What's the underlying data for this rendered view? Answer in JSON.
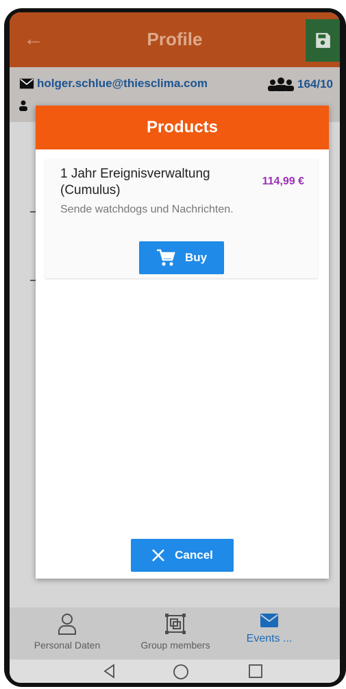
{
  "appbar": {
    "title": "Profile",
    "back_icon": "arrow-left-icon",
    "save_icon": "floppy-disk-icon",
    "colors": {
      "bar": "#c3551f",
      "save": "#2f6e3a"
    }
  },
  "info": {
    "email": "holger.schlue@thiesclima.com",
    "count": "164/10"
  },
  "modal": {
    "title": "Products",
    "product": {
      "name": "1 Jahr Ereignisverwaltung (Cumulus)",
      "price": "114,99 €",
      "description": "Sende watchdogs und Nachrichten.",
      "buy_label": "Buy"
    },
    "cancel_label": "Cancel",
    "colors": {
      "header": "#f15a0f",
      "button": "#1f8ae8",
      "price": "#9b2fb3"
    }
  },
  "bottomnav": {
    "items": [
      {
        "label": "Personal Daten",
        "icon": "person-icon"
      },
      {
        "label": "Group members",
        "icon": "group-frame-icon"
      },
      {
        "label": "Events ...",
        "icon": "envelope-icon"
      }
    ]
  },
  "system_nav": {
    "icons": [
      "back-triangle-icon",
      "home-circle-icon",
      "recents-square-icon"
    ]
  }
}
